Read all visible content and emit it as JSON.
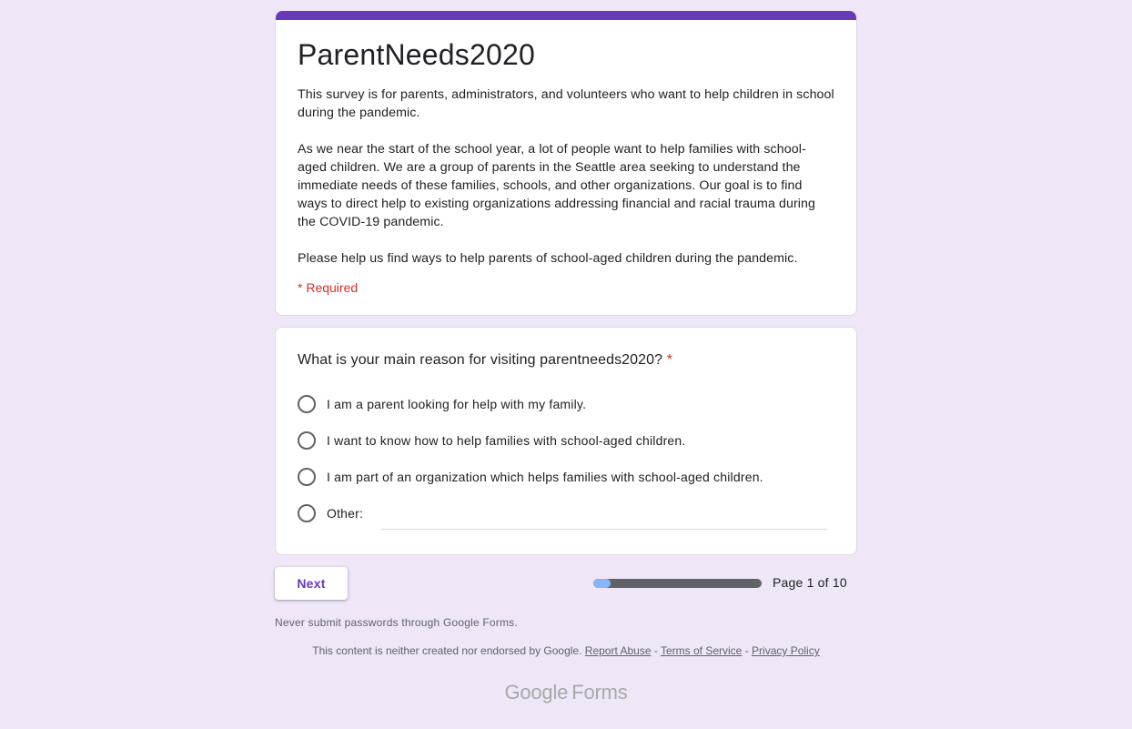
{
  "form": {
    "title": "ParentNeeds2020",
    "description": [
      "This survey is for parents, administrators, and volunteers who want to help children in school during the pandemic.",
      "As we near the start of the school year, a lot of people want to help families with school-aged children. We are a group of parents in the Seattle area seeking to understand the immediate needs of these families, schools, and other organizations. Our goal is to find ways to direct help to existing organizations addressing financial and racial trauma during the COVID-19 pandemic.",
      "Please help us find ways to help parents of school-aged children during the pandemic."
    ],
    "required_note": "* Required"
  },
  "question": {
    "title": "What is your main reason for visiting parentneeds2020?",
    "required_marker": "*",
    "options": [
      "I am a parent looking for help with my family.",
      "I want to know how to help families with school-aged children.",
      "I am part of an organization which helps families with school-aged children.",
      "Other:"
    ],
    "other_value": ""
  },
  "nav": {
    "next_label": "Next",
    "page_label": "Page 1 of 10",
    "progress_fraction": 0.1
  },
  "notices": {
    "password_warning": "Never submit passwords through Google Forms.",
    "disclaimer": "This content is neither created nor endorsed by Google.",
    "separator": "-",
    "report_abuse": "Report Abuse",
    "terms": "Terms of Service",
    "privacy": "Privacy Policy"
  },
  "brand": {
    "google": "Google",
    "forms": "Forms"
  },
  "colors": {
    "page_bg": "#efe7f7",
    "accent": "#673ab7",
    "required": "#d93025",
    "progress_track": "#5f6368",
    "progress_fill": "#8ab4f8"
  }
}
